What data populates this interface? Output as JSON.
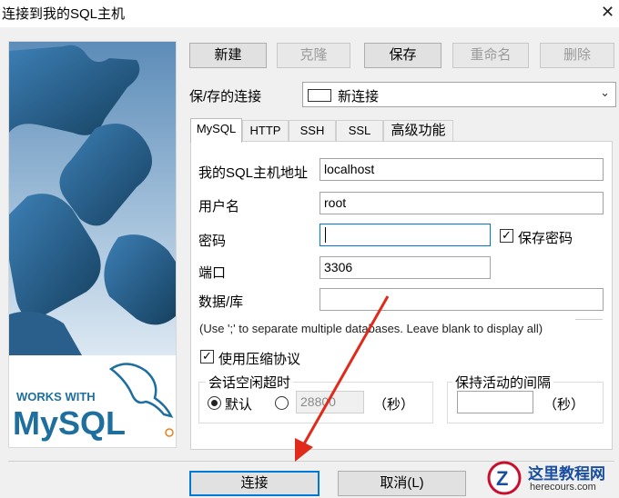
{
  "window": {
    "title": "连接到我的SQL主机",
    "close_glyph": "✕"
  },
  "toolbar": {
    "new": "新建",
    "clone": "克隆",
    "save": "保存",
    "rename": "重命名",
    "delete": "删除"
  },
  "saved_connection": {
    "label": "保/存的连接",
    "value": "新连接"
  },
  "tabs": [
    "MySQL",
    "HTTP",
    "SSH",
    "SSL",
    "高级功能"
  ],
  "form": {
    "host_label": "我的SQL主机地址",
    "host_value": "localhost",
    "user_label": "用户名",
    "user_value": "root",
    "password_label": "密码",
    "password_value": "",
    "save_password_label": "保存密码",
    "save_password_checked": true,
    "port_label": "端口",
    "port_value": "3306",
    "database_label": "数据/库",
    "database_value": "",
    "hint": "(Use ';' to separate multiple databases. Leave blank to display all)",
    "compress_label": "使用压缩协议",
    "compress_checked": true
  },
  "session_timeout": {
    "title": "会话空闲超时",
    "default_label": "默认",
    "custom_value": "28800",
    "unit": "（秒）",
    "selected": "default"
  },
  "keepalive": {
    "title": "保持活动的间隔",
    "value": "",
    "unit": "（秒）"
  },
  "footer": {
    "connect": "连接",
    "cancel": "取消(L)"
  },
  "logo": {
    "works_with": "WORKS WITH",
    "brand": "MySQL",
    "brand_color": "#1f6f9e",
    "accent": "#e6821e"
  },
  "watermark": {
    "name": "这里教程网",
    "url": "herecours.com"
  },
  "colors": {
    "focus_blue": "#0078d7",
    "arrow_red": "#e02a1c",
    "puzzle_blue": "#2b6a9b"
  }
}
